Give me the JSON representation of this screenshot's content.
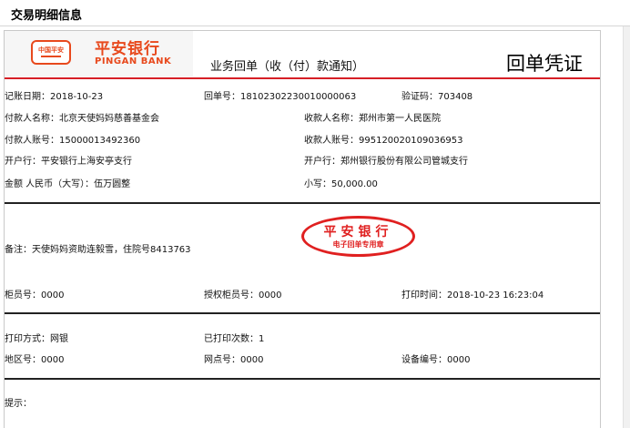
{
  "header": {
    "title": "交易明细信息"
  },
  "receipt": {
    "logo": {
      "badge": "中国平安",
      "name_cn": "平安银行",
      "name_en": "PINGAN BANK"
    },
    "notice_title": "业务回单（收（付）款通知）",
    "voucher_title": "回单凭证",
    "fields": {
      "record_date": "记账日期：2018-10-23",
      "receipt_no": "回单号：18102302230010000063",
      "verify_code": "验证码：703408",
      "payer_name": "付款人名称：北京天使妈妈慈善基金会",
      "payee_name": "收款人名称：郑州市第一人民医院",
      "payer_account": "付款人账号：15000013492360",
      "payee_account": "收款人账号：995120020109036953",
      "payer_bank": "开户行：平安银行上海安亭支行",
      "payee_bank": "开户行：郑州银行股份有限公司管城支行",
      "amount_upper": "金额 人民币（大写）：伍万圆整",
      "amount_lower": "小写：50,000.00",
      "remark": "备注：天使妈妈资助连毅雪，住院号8413763",
      "teller_no": "柜员号：0000",
      "auth_teller_no": "授权柜员号：0000",
      "print_time": "打印时间：2018-10-23 16:23:04",
      "print_method": "打印方式：网银",
      "print_count": "已打印次数：1",
      "area_no": "地区号：0000",
      "branch_no": "网点号：0000",
      "device_no": "设备编号：0000",
      "tips_label": "提示："
    },
    "seal": {
      "main_text": "平安银行",
      "sub_text": "电子回单专用章"
    }
  },
  "colors": {
    "brand_red": "#e8491d",
    "seal_red": "#e02020",
    "rule_red": "#d61f26"
  }
}
